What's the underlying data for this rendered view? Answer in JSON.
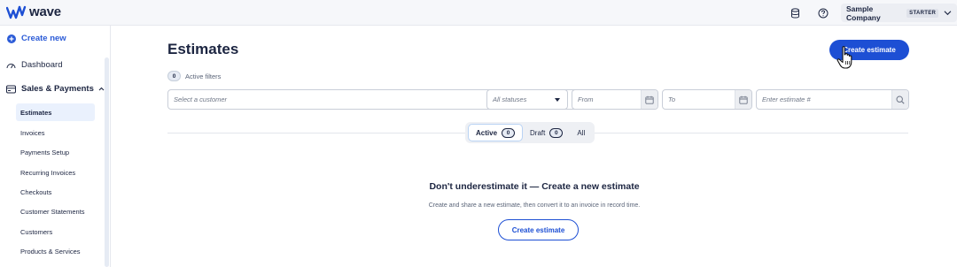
{
  "app": {
    "logo_text": "wave"
  },
  "header": {
    "company_name": "Sample Company",
    "plan_badge": "STARTER"
  },
  "sidebar": {
    "create_new": "Create new",
    "dashboard": "Dashboard",
    "sales_payments": "Sales & Payments",
    "sub_items": [
      "Estimates",
      "Invoices",
      "Payments Setup",
      "Recurring Invoices",
      "Checkouts",
      "Customer Statements",
      "Customers",
      "Products & Services"
    ]
  },
  "main": {
    "title": "Estimates",
    "create_button": "Create estimate",
    "active_filters_count": "0",
    "active_filters_label": "Active filters",
    "customer_placeholder": "Select a customer",
    "status_value": "All statuses",
    "from_placeholder": "From",
    "to_placeholder": "To",
    "estimate_placeholder": "Enter estimate #",
    "tabs": [
      {
        "label": "Active",
        "count": "0"
      },
      {
        "label": "Draft",
        "count": "0"
      },
      {
        "label": "All"
      }
    ],
    "empty_title": "Don't underestimate it — Create a new estimate",
    "empty_subtitle": "Create and share a new estimate, then convert it to an invoice in record time.",
    "empty_button": "Create estimate"
  },
  "colors": {
    "brand_blue": "#1d4fd4",
    "text_dark": "#1c2541",
    "active_nav_bg": "#eaf1fd"
  }
}
